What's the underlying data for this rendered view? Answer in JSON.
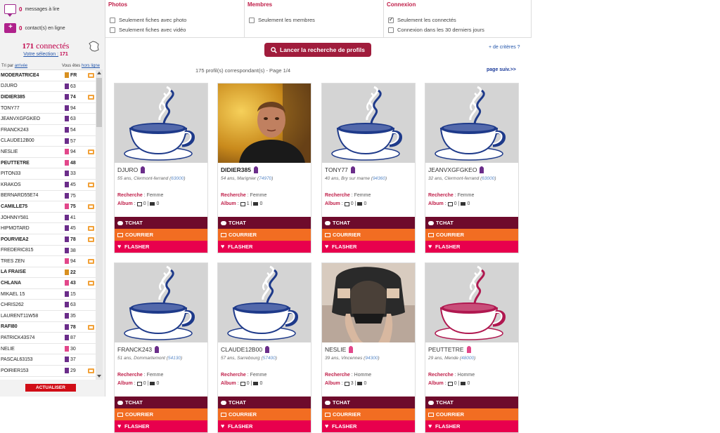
{
  "sidebar": {
    "messages_count": "0",
    "messages_label": "messages à lire",
    "contacts_count": "0",
    "contacts_label": "contact(s) en ligne",
    "connected_count": "171",
    "connected_label": "connectés",
    "selection_label": "Votre sélection :",
    "selection_count": "171",
    "tri_label": "Tri par",
    "tri_link": "arrivée",
    "offline_label": "Vous êtes",
    "offline_link": "hors ligne",
    "refresh_button": "ACTUALISER",
    "users": [
      {
        "name": "MODERATRICE4",
        "num": "FR",
        "gender": "a",
        "bold": true,
        "cam": true
      },
      {
        "name": "DJURO",
        "num": "63",
        "gender": "m",
        "bold": false,
        "cam": false
      },
      {
        "name": "DIDIER385",
        "num": "74",
        "gender": "m",
        "bold": true,
        "cam": true
      },
      {
        "name": "TONY77",
        "num": "94",
        "gender": "m",
        "bold": false,
        "cam": false
      },
      {
        "name": "JEANVXGFGKEO",
        "num": "63",
        "gender": "m",
        "bold": false,
        "cam": false
      },
      {
        "name": "FRANCK243",
        "num": "54",
        "gender": "m",
        "bold": false,
        "cam": false
      },
      {
        "name": "CLAUDE12B00",
        "num": "57",
        "gender": "m",
        "bold": false,
        "cam": false
      },
      {
        "name": "NESLIE",
        "num": "94",
        "gender": "f",
        "bold": false,
        "cam": true
      },
      {
        "name": "PEUTTETRE",
        "num": "48",
        "gender": "f",
        "bold": true,
        "cam": false
      },
      {
        "name": "PITON33",
        "num": "33",
        "gender": "m",
        "bold": false,
        "cam": false
      },
      {
        "name": "KRAKOS",
        "num": "45",
        "gender": "m",
        "bold": false,
        "cam": true
      },
      {
        "name": "BERNARD55E74",
        "num": "75",
        "gender": "m",
        "bold": false,
        "cam": false
      },
      {
        "name": "CAMILLE75",
        "num": "75",
        "gender": "f",
        "bold": true,
        "cam": true
      },
      {
        "name": "JOHNNY581",
        "num": "41",
        "gender": "m",
        "bold": false,
        "cam": false
      },
      {
        "name": "HIPMOTARD",
        "num": "45",
        "gender": "m",
        "bold": false,
        "cam": true
      },
      {
        "name": "POURVIEA2",
        "num": "78",
        "gender": "m",
        "bold": true,
        "cam": true
      },
      {
        "name": "FREDERIC815",
        "num": "38",
        "gender": "m",
        "bold": false,
        "cam": false
      },
      {
        "name": "TRES ZEN",
        "num": "94",
        "gender": "f",
        "bold": false,
        "cam": true
      },
      {
        "name": "LA FRAISE",
        "num": "22",
        "gender": "a",
        "bold": true,
        "cam": false
      },
      {
        "name": "CHLANA",
        "num": "43",
        "gender": "f",
        "bold": true,
        "cam": true
      },
      {
        "name": "MIKAEL 15",
        "num": "15",
        "gender": "m",
        "bold": false,
        "cam": false
      },
      {
        "name": "CHRIS262",
        "num": "63",
        "gender": "m",
        "bold": false,
        "cam": false
      },
      {
        "name": "LAURENT11W58",
        "num": "35",
        "gender": "m",
        "bold": false,
        "cam": false
      },
      {
        "name": "RAFI80",
        "num": "78",
        "gender": "m",
        "bold": true,
        "cam": true
      },
      {
        "name": "PATRICK43S74",
        "num": "87",
        "gender": "m",
        "bold": false,
        "cam": false
      },
      {
        "name": "NELIE",
        "num": "30",
        "gender": "f",
        "bold": false,
        "cam": false
      },
      {
        "name": "PASCAL63153",
        "num": "37",
        "gender": "m",
        "bold": false,
        "cam": false
      },
      {
        "name": "POIRIER153",
        "num": "29",
        "gender": "m",
        "bold": false,
        "cam": true
      }
    ]
  },
  "filters": {
    "photos_title": "Photos",
    "photos_opt1": "Seulement fiches avec photo",
    "photos_opt2": "Seulement fiches avec vidéo",
    "membres_title": "Membres",
    "membres_opt1": "Seulement les membres",
    "connexion_title": "Connexion",
    "connexion_opt1": "Seulement les connectés",
    "connexion_opt2": "Connexion dans les 30 derniers jours"
  },
  "search_button": "Lancer la recherche de profils",
  "more_criteria": "+ de critères ?",
  "result_count": "175 profil(s) correspondant(s) - Page 1/4",
  "next_page": "page suiv.>>",
  "labels": {
    "recherche": "Recherche",
    "album": "Album",
    "tchat": "TCHAT",
    "courrier": "COURRIER",
    "flasher": "FLASHER"
  },
  "profiles": [
    {
      "name": "DJURO",
      "gender": "m",
      "age_city": "55 ans, Clermont-ferrand",
      "zip": "63000",
      "seeks": "Femme",
      "photos": "0",
      "videos": "0",
      "photo": "cup",
      "bold": false
    },
    {
      "name": "DIDIER385",
      "gender": "m",
      "age_city": "54 ans, Marignier",
      "zip": "74970",
      "seeks": "Femme",
      "photos": "1",
      "videos": "0",
      "photo": "person",
      "bold": true
    },
    {
      "name": "TONY77",
      "gender": "m",
      "age_city": "40 ans, Bry sur marne",
      "zip": "94360",
      "seeks": "Femme",
      "photos": "0",
      "videos": "0",
      "photo": "cup",
      "bold": false
    },
    {
      "name": "JEANVXGFGKEO",
      "gender": "m",
      "age_city": "32 ans, Clermont-ferrand",
      "zip": "63000",
      "seeks": "Femme",
      "photos": "0",
      "videos": "0",
      "photo": "cup",
      "bold": false
    },
    {
      "name": "FRANCK243",
      "gender": "m",
      "age_city": "51 ans, Dommartemont",
      "zip": "54130",
      "seeks": "Femme",
      "photos": "0",
      "videos": "0",
      "photo": "cup",
      "bold": false
    },
    {
      "name": "CLAUDE12B00",
      "gender": "m",
      "age_city": "57 ans, Sarrebourg",
      "zip": "57400",
      "seeks": "Femme",
      "photos": "0",
      "videos": "0",
      "photo": "cup",
      "bold": false
    },
    {
      "name": "NESLIE",
      "gender": "f",
      "age_city": "39 ans, Vincennes",
      "zip": "94300",
      "seeks": "Homme",
      "photos": "3",
      "videos": "0",
      "photo": "photo2",
      "bold": false
    },
    {
      "name": "PEUTTETRE",
      "gender": "f",
      "age_city": "29 ans, Mende",
      "zip": "48000",
      "seeks": "Homme",
      "photos": "0",
      "videos": "0",
      "photo": "cup-pink",
      "bold": false
    }
  ]
}
